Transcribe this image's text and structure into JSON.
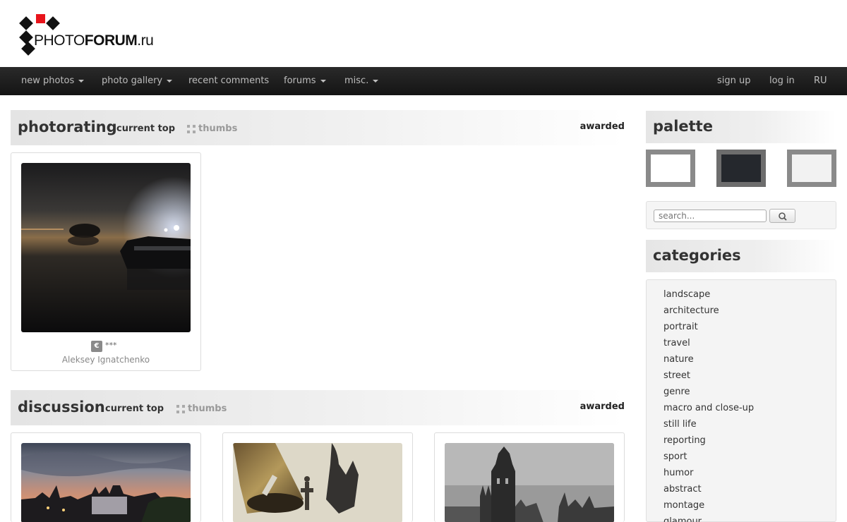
{
  "logo": {
    "text_plain": "PHOTO",
    "text_bold": "FORUM",
    "text_suffix": ".ru"
  },
  "nav": {
    "left": [
      {
        "label": "new photos",
        "dropdown": true
      },
      {
        "label": "photo gallery",
        "dropdown": true
      },
      {
        "label": "recent comments",
        "dropdown": false
      },
      {
        "label": "forums",
        "dropdown": true
      },
      {
        "label": "misc.",
        "dropdown": true
      }
    ],
    "right": [
      "sign up",
      "log in",
      "RU"
    ]
  },
  "photorating": {
    "title": "photorating",
    "subtitle": "current top",
    "thumbs": "thumbs",
    "awarded": "awarded",
    "card": {
      "badge": "€",
      "stars": "***",
      "author": "Aleksey Ignatchenko"
    }
  },
  "discussion": {
    "title": "discussion",
    "subtitle": "current top",
    "thumbs": "thumbs",
    "awarded": "awarded"
  },
  "sidebar": {
    "palette_title": "palette",
    "palette_colors": [
      "#ffffff",
      "#25282d",
      "#f2f2f2"
    ],
    "search_placeholder": "search...",
    "categories_title": "categories",
    "categories": [
      "landscape",
      "architecture",
      "portrait",
      "travel",
      "nature",
      "street",
      "genre",
      "macro and close-up",
      "still life",
      "reporting",
      "sport",
      "humor",
      "abstract",
      "montage",
      "glamour"
    ]
  }
}
